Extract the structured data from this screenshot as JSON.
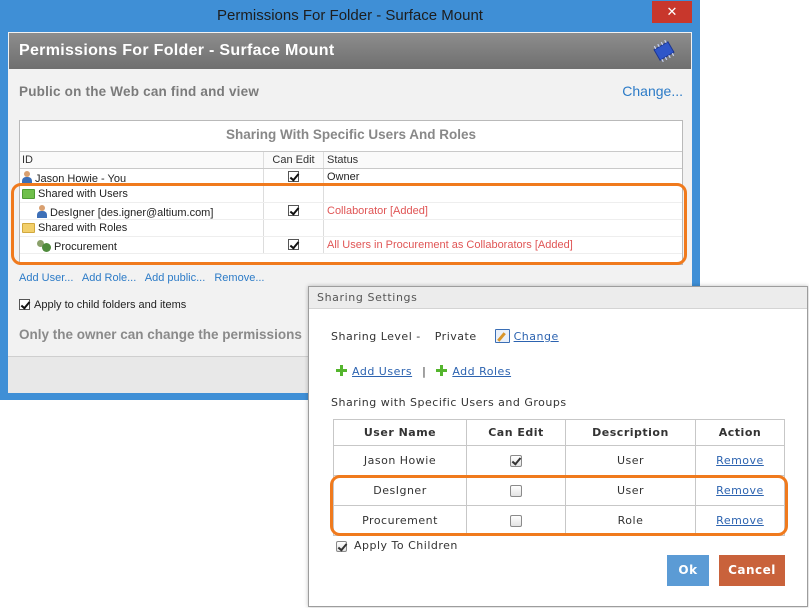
{
  "window1": {
    "title": "Permissions For Folder - Surface Mount",
    "close_glyph": "✕",
    "header_title": "Permissions For Folder - Surface Mount",
    "header_icon": "chip-icon",
    "public_text": "Public on the Web can find and view",
    "change_link": "Change...",
    "panel_title": "Sharing With Specific Users And Roles",
    "columns": [
      "ID",
      "Can Edit",
      "Status"
    ],
    "rows": [
      {
        "id": "Jason Howie - You",
        "can_edit": true,
        "status": "Owner",
        "icon": "user-icon"
      },
      {
        "id": "Shared with Users",
        "can_edit": null,
        "status": "",
        "icon": "folder-green-icon"
      },
      {
        "id": "DesIgner [des.igner@altium.com]",
        "can_edit": true,
        "status": "Collaborator [Added]",
        "icon": "user-icon"
      },
      {
        "id": "Shared with Roles",
        "can_edit": null,
        "status": "",
        "icon": "folder-yellow-icon"
      },
      {
        "id": "Procurement",
        "can_edit": true,
        "status": "All Users in Procurement as Collaborators [Added]",
        "icon": "role-icon"
      }
    ],
    "links": [
      "Add User...",
      "Add Role...",
      "Add public...",
      "Remove..."
    ],
    "apply_children_label": "Apply to child folders and items",
    "apply_children_checked": true,
    "owner_note": "Only the owner can change the permissions"
  },
  "window2": {
    "title": "Sharing Settings",
    "sharing_level_label": "Sharing Level -",
    "sharing_level_value": "Private",
    "change_link": "Change",
    "add_users": "Add Users",
    "separator": "|",
    "add_roles": "Add Roles",
    "section_label": "Sharing with Specific Users and Groups",
    "columns": [
      "User Name",
      "Can Edit",
      "Description",
      "Action"
    ],
    "rows": [
      {
        "name": "Jason Howie",
        "can_edit": true,
        "description": "User",
        "action": "Remove"
      },
      {
        "name": "DesIgner",
        "can_edit": false,
        "description": "User",
        "action": "Remove"
      },
      {
        "name": "Procurement",
        "can_edit": false,
        "description": "Role",
        "action": "Remove"
      }
    ],
    "apply_children_label": "Apply To Children",
    "apply_children_checked": true,
    "ok_button": "Ok",
    "cancel_button": "Cancel"
  },
  "colors": {
    "title_bar": "#3f8fd6",
    "close_button": "#c8372c",
    "highlight": "#f07a1d",
    "link": "#2c7bc7",
    "status_red": "#e05555",
    "ok_button": "#5b9bd5",
    "cancel_button": "#c9623b"
  }
}
